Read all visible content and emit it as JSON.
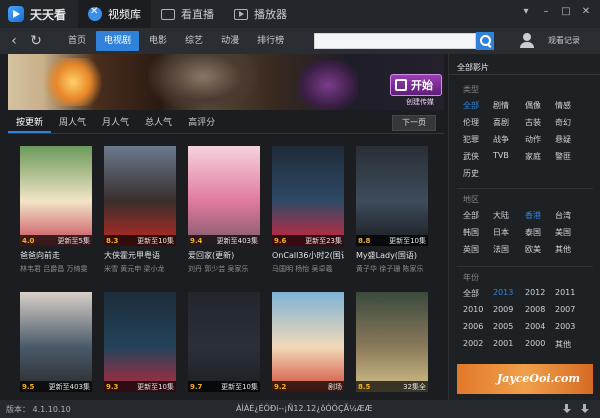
{
  "app": {
    "name": "天天看",
    "tabs": [
      {
        "label": "视频库",
        "icon": "video-library-icon"
      },
      {
        "label": "看直播",
        "icon": "live-tv-icon"
      },
      {
        "label": "播放器",
        "icon": "player-icon"
      }
    ]
  },
  "nav": {
    "items": [
      "首页",
      "电视剧",
      "电影",
      "综艺",
      "动漫",
      "排行榜"
    ],
    "active": "电视剧",
    "search_value": "",
    "history_label": "观看记录"
  },
  "banner": {
    "start_label": "开始",
    "sub_label": "创建传媒"
  },
  "sort": {
    "tabs": [
      "按更新",
      "周人气",
      "月人气",
      "总人气",
      "高评分"
    ],
    "active": "按更新",
    "next_page": "下一页"
  },
  "shows": [
    {
      "rating": "4.0",
      "update": "更新至5集",
      "title": "爸爸向前走",
      "cast": "林韦君 吕爵昌 万绮雯",
      "colors": [
        "#6a9a5b",
        "#f2e4c6",
        "#c94a5a"
      ]
    },
    {
      "rating": "8.3",
      "update": "更新至10集",
      "title": "大侠霍元甲粤语",
      "cast": "米雪 黄元申 梁小龙",
      "colors": [
        "#6b7a8f",
        "#3a2e2c",
        "#c12a22"
      ]
    },
    {
      "rating": "9.4",
      "update": "更新至403集",
      "title": "爱回家(更新)",
      "cast": "刘丹 郭少芸 吴家乐",
      "colors": [
        "#f4d2dc",
        "#e27aa0",
        "#7c5a6a"
      ]
    },
    {
      "rating": "9.6",
      "update": "更新至23集",
      "title": "OnCall36小时2(国语)",
      "cast": "马国明 杨怡 吴卓羲",
      "colors": [
        "#1e2a38",
        "#2f4a66",
        "#d6243c"
      ]
    },
    {
      "rating": "8.8",
      "update": "更新至10集",
      "title": "My盛Lady(国语)",
      "cast": "黄子华 徐子珊 陈家乐",
      "colors": [
        "#2a2e36",
        "#3d4c5c",
        "#1a1c20"
      ]
    },
    {
      "rating": "9.5",
      "update": "更新至403集",
      "title": "",
      "cast": "",
      "colors": [
        "#d8d0c8",
        "#4a5a6a",
        "#2a2a2a"
      ]
    },
    {
      "rating": "9.3",
      "update": "更新至10集",
      "title": "",
      "cast": "",
      "colors": [
        "#1d2c3a",
        "#23435a",
        "#b62a3c"
      ]
    },
    {
      "rating": "9.7",
      "update": "更新至10集",
      "title": "",
      "cast": "",
      "colors": [
        "#22262c",
        "#2b3038",
        "#1c1f24"
      ]
    },
    {
      "rating": "9.2",
      "update": "剧场",
      "title": "",
      "cast": "",
      "colors": [
        "#7db3d6",
        "#f1d9b8",
        "#d24a3a"
      ]
    },
    {
      "rating": "8.5",
      "update": "32集全",
      "title": "",
      "cast": "",
      "colors": [
        "#3a4a3e",
        "#8a7a5a",
        "#d4c28a"
      ]
    }
  ],
  "side": {
    "title": "全部影片",
    "sections": [
      {
        "label": "类型",
        "options": [
          "全部",
          "剧情",
          "偶像",
          "情感",
          "伦理",
          "喜剧",
          "古装",
          "奇幻",
          "犯罪",
          "战争",
          "动作",
          "悬疑",
          "武侠",
          "TVB",
          "家庭",
          "警匪",
          "历史"
        ],
        "active": "全部"
      },
      {
        "label": "地区",
        "options": [
          "全部",
          "大陆",
          "香港",
          "台湾",
          "韩国",
          "日本",
          "泰国",
          "美国",
          "英国",
          "法国",
          "欧美",
          "其他"
        ],
        "active": "香港"
      },
      {
        "label": "年份",
        "options": [
          "全部",
          "2013",
          "2012",
          "2011",
          "2010",
          "2009",
          "2008",
          "2007",
          "2006",
          "2005",
          "2004",
          "2003",
          "2002",
          "2001",
          "2000",
          "其他"
        ],
        "active": "2013"
      }
    ],
    "promo_text": "JayceOoi.com"
  },
  "status": {
    "version": "版本： 4.1.10.10",
    "message": "ÀÌÀÉ¿ÉÓÐi--¡Ñ12.12¿ôÓÓÇÃ¼ÆÆ"
  },
  "colors": {
    "accent": "#2f82d8",
    "rating": "#f2b025",
    "background": "#1b1d20"
  }
}
